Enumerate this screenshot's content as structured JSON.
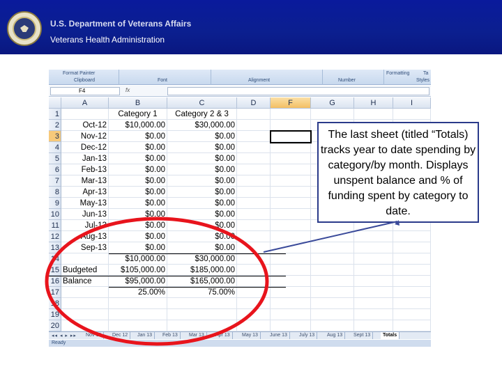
{
  "banner": {
    "title": "U.S. Department of Veterans Affairs",
    "subtitle": "Veterans Health Administration"
  },
  "ribbon": {
    "groups": [
      "Clipboard",
      "Font",
      "Alignment",
      "Number",
      "Styles"
    ],
    "top_items": [
      "Format Painter",
      "Formatting",
      "Ta"
    ]
  },
  "formula_bar": {
    "name_box": "F4",
    "fx": "fx",
    "value": ""
  },
  "columns": [
    "A",
    "B",
    "C",
    "D",
    "F",
    "G",
    "H",
    "I"
  ],
  "selected_column": "F",
  "selected_row": "3",
  "row_numbers": [
    "1",
    "2",
    "3",
    "4",
    "5",
    "6",
    "7",
    "8",
    "9",
    "10",
    "11",
    "12",
    "13",
    "14",
    "15",
    "16",
    "17",
    "18",
    "19",
    "20"
  ],
  "sheet": {
    "header": [
      "",
      "Category 1",
      "Category 2 & 3"
    ],
    "rows": [
      [
        "Oct-12",
        "$10,000.00",
        "$30,000.00"
      ],
      [
        "Nov-12",
        "$0.00",
        "$0.00"
      ],
      [
        "Dec-12",
        "$0.00",
        "$0.00"
      ],
      [
        "Jan-13",
        "$0.00",
        "$0.00"
      ],
      [
        "Feb-13",
        "$0.00",
        "$0.00"
      ],
      [
        "Mar-13",
        "$0.00",
        "$0.00"
      ],
      [
        "Apr-13",
        "$0.00",
        "$0.00"
      ],
      [
        "May-13",
        "$0.00",
        "$0.00"
      ],
      [
        "Jun-13",
        "$0.00",
        "$0.00"
      ],
      [
        "Jul-13",
        "$0.00",
        "$0.00"
      ],
      [
        "Aug-13",
        "$0.00",
        "$0.00"
      ],
      [
        "Sep-13",
        "$0.00",
        "$0.00"
      ],
      [
        "",
        "$10,000.00",
        "$30,000.00"
      ],
      [
        "Budgeted",
        "$105,000.00",
        "$185,000.00"
      ],
      [
        "Balance",
        "$95,000.00",
        "$165,000.00"
      ],
      [
        "",
        "25.00%",
        "75.00%"
      ]
    ]
  },
  "tabs": {
    "nav": "◂◂ ◂ ▸ ▸▸",
    "items": [
      "Nov 12",
      "Dec 12",
      "Jan 13",
      "Feb 13",
      "Mar 13",
      "Apr 13",
      "May 13",
      "June 13",
      "July 13",
      "Aug 13",
      "Sept 13",
      "Totals"
    ],
    "active": "Totals"
  },
  "status_bar": "Ready",
  "callout": {
    "text": "The last sheet (titled “Totals) tracks year to date spending by category/by month. Displays unspent balance and % of funding spent by category to date."
  },
  "colors": {
    "banner": "#0b1f8f",
    "highlight_circle": "#e8141c",
    "callout_border": "#2a3a8a",
    "selected_header": "#f3bf64"
  }
}
